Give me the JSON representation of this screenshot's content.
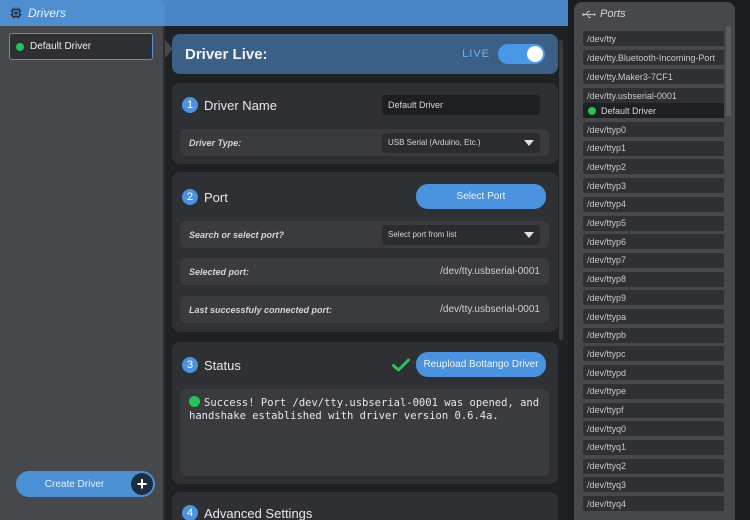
{
  "drivers_panel": {
    "title": "Drivers",
    "items": [
      {
        "label": "Default Driver",
        "status_color": "#27c25a"
      }
    ],
    "create_button": "Create Driver"
  },
  "live_card": {
    "title": "Driver Live:",
    "live_label": "LIVE",
    "live_on": true
  },
  "section_name": {
    "number": "1",
    "title": "Driver Name",
    "name_value": "Default Driver",
    "type_label": "Driver Type:",
    "type_value": "USB Serial (Arduino, Etc.)"
  },
  "section_port": {
    "number": "2",
    "title": "Port",
    "select_button": "Select Port",
    "search_label": "Search or select port?",
    "search_placeholder": "Select port from list",
    "selected_label": "Selected port:",
    "selected_value": "/dev/tty.usbserial-0001",
    "last_label": "Last successfuly connected port:",
    "last_value": "/dev/tty.usbserial-0001"
  },
  "section_status": {
    "number": "3",
    "title": "Status",
    "reupload_button": "Reupload Bottango Driver",
    "message": "Success! Port /dev/tty.usbserial-0001 was opened, and handshake established with driver version 0.6.4a."
  },
  "section_advanced": {
    "number": "4",
    "title": "Advanced Settings"
  },
  "ports_panel": {
    "title": "Ports",
    "items": [
      "/dev/tty",
      "/dev/tty.Bluetooth-Incoming-Port",
      "/dev/tty.Maker3-7CF1",
      "/dev/tty.usbserial-0001"
    ],
    "active_driver": "Default Driver",
    "more_items": [
      "/dev/ttyp0",
      "/dev/ttyp1",
      "/dev/ttyp2",
      "/dev/ttyp3",
      "/dev/ttyp4",
      "/dev/ttyp5",
      "/dev/ttyp6",
      "/dev/ttyp7",
      "/dev/ttyp8",
      "/dev/ttyp9",
      "/dev/ttypa",
      "/dev/ttypb",
      "/dev/ttypc",
      "/dev/ttypd",
      "/dev/ttype",
      "/dev/ttypf",
      "/dev/ttyq0",
      "/dev/ttyq1",
      "/dev/ttyq2",
      "/dev/ttyq3",
      "/dev/ttyq4"
    ]
  },
  "colors": {
    "accent": "#4b92df",
    "success": "#27c25a",
    "panel": "#47484b"
  }
}
